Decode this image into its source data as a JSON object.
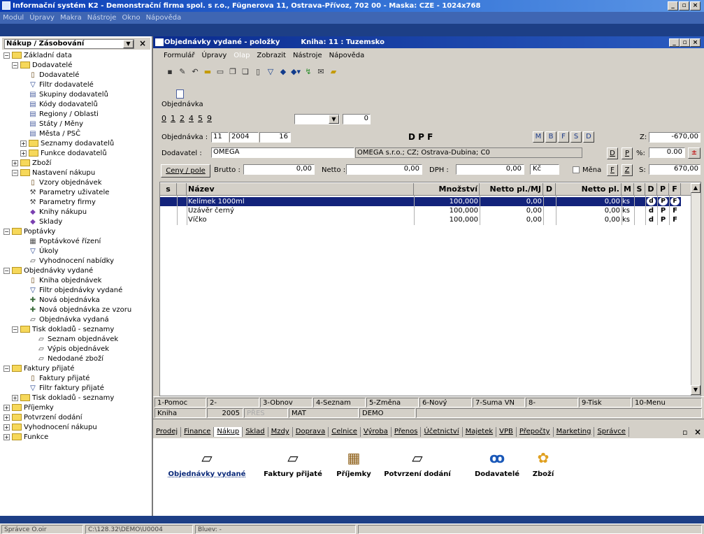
{
  "app": {
    "title": "Informační systém K2 - Demonstrační firma spol. s r.o., Fügnerova 11, Ostrava-Přívoz, 702 00 - Maska: CZE - 1024x768",
    "menu": [
      "Modul",
      "Úpravy",
      "Makra",
      "Nástroje",
      "Okno",
      "Nápověda"
    ],
    "minimize": "_",
    "restore": "▫",
    "close": "×"
  },
  "left_panel": {
    "combo_value": "Nákup / Zásobování",
    "tree": [
      {
        "label": "Základní data",
        "level": 0,
        "type": "folder",
        "exp": "−"
      },
      {
        "label": "Dodavatelé",
        "level": 1,
        "type": "folder",
        "exp": "−"
      },
      {
        "label": "Dodavatelé",
        "level": 2,
        "type": "book"
      },
      {
        "label": "Filtr dodavatelé",
        "level": 2,
        "type": "filter"
      },
      {
        "label": "Skupiny dodavatelů",
        "level": 2,
        "type": "doc"
      },
      {
        "label": "Kódy dodavatelů",
        "level": 2,
        "type": "doc"
      },
      {
        "label": "Regiony / Oblasti",
        "level": 2,
        "type": "doc"
      },
      {
        "label": "Státy / Měny",
        "level": 2,
        "type": "doc"
      },
      {
        "label": "Města / PSČ",
        "level": 2,
        "type": "doc"
      },
      {
        "label": "Seznamy dodavatelů",
        "level": 2,
        "type": "folder",
        "exp": "+"
      },
      {
        "label": "Funkce dodavatelů",
        "level": 2,
        "type": "folder",
        "exp": "+"
      },
      {
        "label": "Zboží",
        "level": 1,
        "type": "folder",
        "exp": "+"
      },
      {
        "label": "Nastavení nákupu",
        "level": 1,
        "type": "folder",
        "exp": "−"
      },
      {
        "label": "Vzory objednávek",
        "level": 2,
        "type": "book"
      },
      {
        "label": "Parametry uživatele",
        "level": 2,
        "type": "tool"
      },
      {
        "label": "Parametry firmy",
        "level": 2,
        "type": "tool"
      },
      {
        "label": "Knihy nákupu",
        "level": 2,
        "type": "gem"
      },
      {
        "label": "Sklady",
        "level": 2,
        "type": "gem"
      },
      {
        "label": "Poptávky",
        "level": 0,
        "type": "folder",
        "exp": "−"
      },
      {
        "label": "Poptávkové řízení",
        "level": 2,
        "type": "table"
      },
      {
        "label": "Úkoly",
        "level": 2,
        "type": "filter"
      },
      {
        "label": "Vyhodnocení nabídky",
        "level": 2,
        "type": "printer"
      },
      {
        "label": "Objednávky vydané",
        "level": 0,
        "type": "folder",
        "exp": "−"
      },
      {
        "label": "Kniha objednávek",
        "level": 2,
        "type": "book"
      },
      {
        "label": "Filtr objednávky vydané",
        "level": 2,
        "type": "filter"
      },
      {
        "label": "Nová objednávka",
        "level": 2,
        "type": "new"
      },
      {
        "label": "Nová objednávka ze vzoru",
        "level": 2,
        "type": "new"
      },
      {
        "label": "Objednávka vydaná",
        "level": 2,
        "type": "printer"
      },
      {
        "label": "Tisk dokladů - seznamy",
        "level": 1,
        "type": "folder",
        "exp": "−"
      },
      {
        "label": "Seznam objednávek",
        "level": 3,
        "type": "printer"
      },
      {
        "label": "Výpis objednávek",
        "level": 3,
        "type": "printer"
      },
      {
        "label": "Nedodané zboží",
        "level": 3,
        "type": "printer"
      },
      {
        "label": "Faktury přijaté",
        "level": 0,
        "type": "folder",
        "exp": "−"
      },
      {
        "label": "Faktury přijaté",
        "level": 2,
        "type": "book"
      },
      {
        "label": "Filtr faktury přijaté",
        "level": 2,
        "type": "filter"
      },
      {
        "label": "Tisk dokladů - seznamy",
        "level": 1,
        "type": "folder",
        "exp": "+"
      },
      {
        "label": "Příjemky",
        "level": 0,
        "type": "folder",
        "exp": "+"
      },
      {
        "label": "Potvrzení dodání",
        "level": 0,
        "type": "folder",
        "exp": "+"
      },
      {
        "label": "Vyhodnocení nákupu",
        "level": 0,
        "type": "folder",
        "exp": "+"
      },
      {
        "label": "Funkce",
        "level": 0,
        "type": "folder",
        "exp": "+"
      }
    ]
  },
  "form": {
    "title": "Objednávky vydané - položky",
    "book": "Kniha: 11 : Tuzemsko",
    "menu": [
      "Formulář",
      "Úpravy",
      "Olap",
      "Zobrazit",
      "Nástroje",
      "Nápověda"
    ],
    "toolbar_caption": "Objednávka",
    "pages": [
      "0",
      "1",
      "2",
      "4",
      "5",
      "9"
    ],
    "page_value": "0",
    "order_label": "Objednávka :",
    "order_book": "11",
    "order_year": "2004",
    "order_number": "16",
    "dpf": "D P F",
    "flags": [
      "M",
      "B",
      "F",
      "S",
      "D"
    ],
    "z_label": "Z:",
    "z_value": "-670,00",
    "supplier_label": "Dodavatel :",
    "supplier_code": "OMEGA",
    "supplier_name": "OMEGA s.r.o.; CZ; Ostrava-Dubina; C0",
    "btn_d": "D",
    "btn_p": "P",
    "pct_label": "%:",
    "pct_value": "0.00",
    "prices_button": "Ceny / pole",
    "brutto_label": "Brutto :",
    "brutto_value": "0,00",
    "netto_label": "Netto :",
    "netto_value": "0,00",
    "dph_label": "DPH :",
    "dph_value": "0,00",
    "currency": "Kč",
    "mena_label": "Měna",
    "btn_f": "F",
    "btn_z": "Z",
    "s_label": "S:",
    "s_value": "670,00"
  },
  "grid": {
    "headers": [
      "s",
      "Název",
      "Množství",
      "Netto pl./MJ",
      "D",
      "Netto pl.",
      "M",
      "S",
      "D",
      "P",
      "F"
    ],
    "rows": [
      {
        "name": "Kelímek 1000ml",
        "qty": "100,000",
        "mj": "0,00",
        "netto": "0,00",
        "unit": "ks",
        "d": "d",
        "p": "P",
        "f": "F"
      },
      {
        "name": "Uzávěr černý",
        "qty": "100,000",
        "mj": "0,00",
        "netto": "0,00",
        "unit": "ks",
        "d": "d",
        "p": "P",
        "f": "F"
      },
      {
        "name": "Víčko",
        "qty": "100,000",
        "mj": "0,00",
        "netto": "0,00",
        "unit": "ks",
        "d": "d",
        "p": "P",
        "f": "F"
      }
    ]
  },
  "fkeys": [
    "1-Pomoc",
    "2-",
    "3-Obnov",
    "4-Seznam",
    "5-Změna",
    "6-Nový",
    "7-Suma VN",
    "8-",
    "9-Tisk",
    "10-Menu"
  ],
  "status": [
    "Kniha",
    "2005",
    "PŘES",
    "MAT",
    "DEMO"
  ],
  "module_tabs": [
    "Prodej",
    "Finance",
    "Nákup",
    "Sklad",
    "Mzdy",
    "Doprava",
    "Celnice",
    "Výroba",
    "Přenos",
    "Účetnictví",
    "Majetek",
    "VPB",
    "Přepočty",
    "Marketing",
    "Správce"
  ],
  "shortcuts": [
    {
      "label": "Objednávky vydané",
      "icon": "printer-icon"
    },
    {
      "label": "Faktury přijaté",
      "icon": "printer-icon"
    },
    {
      "label": "Příjemky",
      "icon": "building-icon"
    },
    {
      "label": "Potvrzení dodání",
      "icon": "printer-icon"
    },
    {
      "label": "Dodavatelé",
      "icon": "people-icon"
    },
    {
      "label": "Zboží",
      "icon": "goods-icon"
    }
  ],
  "bottom_status": [
    "Správce O.oir",
    "C:\\128.32\\DEMO\\U0004",
    "Bluev: -"
  ]
}
